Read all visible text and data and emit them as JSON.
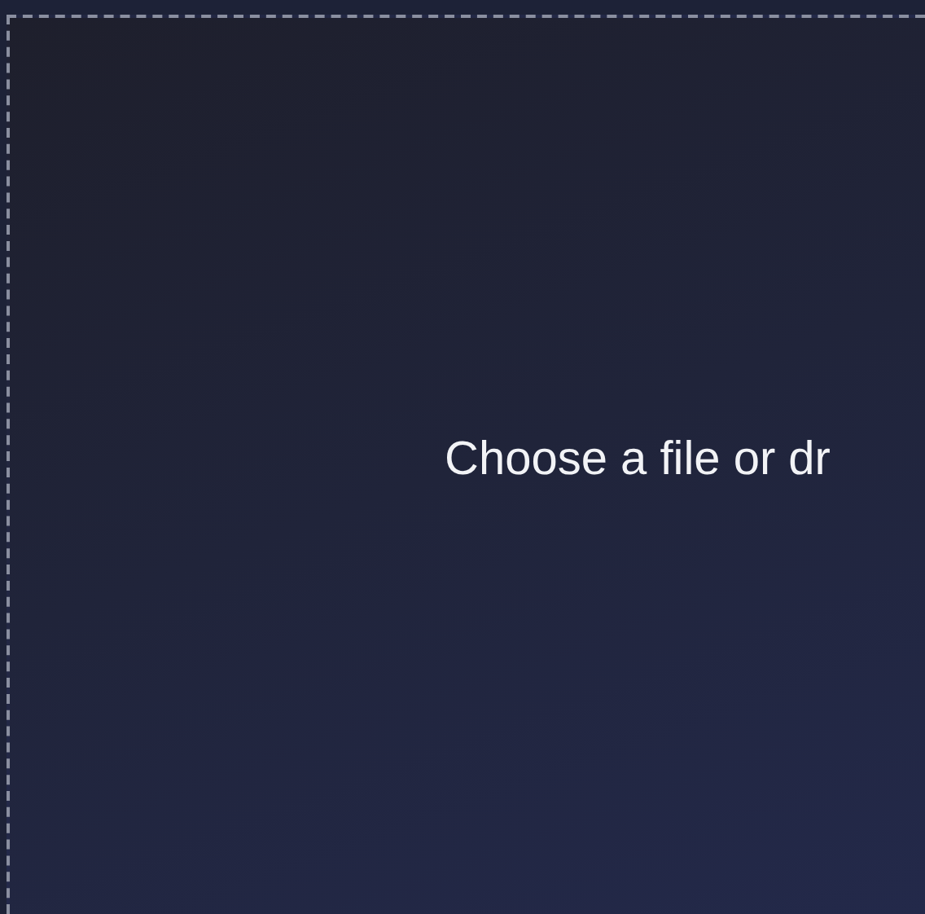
{
  "dropzone": {
    "prompt": "Choose a file or dr"
  }
}
